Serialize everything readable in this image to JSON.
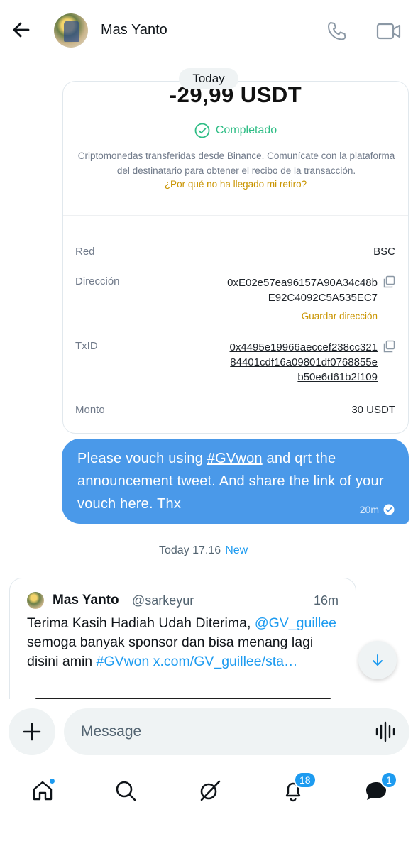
{
  "header": {
    "contact_name": "Mas Yanto"
  },
  "date_pill": "Today",
  "transaction": {
    "amount": "-29,99 USDT",
    "status": "Completado",
    "description": "Criptomonedas transferidas desde Binance. Comunícate con la plataforma del destinatario para obtener el recibo de la transacción.",
    "why_link": "¿Por qué no ha llegado mi retiro?",
    "rows": {
      "red_label": "Red",
      "red_value": "BSC",
      "direccion_label": "Dirección",
      "direccion_line1": "0xE02e57ea96157A90A34c48b",
      "direccion_line2": "E92C4092C5A535EC7",
      "save_address": "Guardar dirección",
      "txid_label": "TxID",
      "txid_line1": "0x4495e19966aeccef238cc321",
      "txid_line2": "84401cdf16a09801df0768855e",
      "txid_line3": "b50e6d61b2f109",
      "monto_label": "Monto",
      "monto_value": "30 USDT"
    }
  },
  "sent_message": {
    "text_before": "Please vouch using ",
    "hashtag": "#GVwon",
    "text_after": " and qrt the announcement tweet. And share the link of your vouch here. Thx",
    "time": "20m"
  },
  "divider": {
    "text": "Today 17.16",
    "new_label": "New"
  },
  "tweet": {
    "name": "Mas Yanto",
    "handle": "@sarkeyur",
    "time": "16m",
    "text_1": "Terima Kasih Hadiah Udah Diterima, ",
    "mention": "@GV_guillee",
    "text_2": " semoga banyak sponsor dan bisa menang lagi disini amin ",
    "hashtag": "#GVwon",
    "link": "x.com/GV_guillee/sta…"
  },
  "composer": {
    "placeholder": "Message"
  },
  "nav": {
    "notifications_badge": "18",
    "messages_badge": "1"
  },
  "colors": {
    "accent": "#1d9bf0",
    "bubble": "#4a99e9",
    "success": "#2ebd85",
    "binance_gold": "#c99400"
  },
  "icons": [
    "back-arrow-icon",
    "phone-icon",
    "video-camera-icon",
    "check-circle-icon",
    "copy-icon",
    "read-check-icon",
    "arrow-down-icon",
    "plus-icon",
    "voice-waveform-icon",
    "home-icon",
    "search-icon",
    "grok-icon",
    "bell-icon",
    "messages-icon"
  ]
}
